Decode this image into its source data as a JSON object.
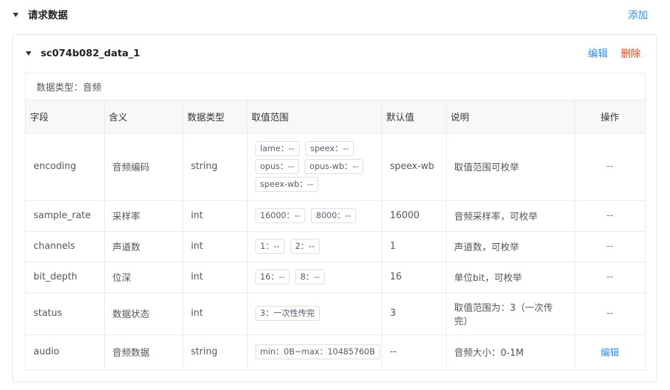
{
  "section": {
    "title": "请求数据",
    "add_label": "添加"
  },
  "card": {
    "title": "sc074b082_data_1",
    "edit_label": "编辑",
    "delete_label": "删除"
  },
  "data_type_line": "数据类型：音频",
  "columns": [
    "字段",
    "含义",
    "数据类型",
    "取值范围",
    "默认值",
    "说明",
    "操作"
  ],
  "rows": [
    {
      "field": "encoding",
      "meaning": "音频编码",
      "type": "string",
      "range": [
        "lame：--",
        "speex：--",
        "opus：--",
        "opus-wb：--",
        "speex-wb：--"
      ],
      "default": "speex-wb",
      "desc": "取值范围可枚举",
      "op": "--",
      "op_link": false
    },
    {
      "field": "sample_rate",
      "meaning": "采样率",
      "type": "int",
      "range": [
        "16000：--",
        "8000：--"
      ],
      "default": "16000",
      "desc": "音频采样率，可枚举",
      "op": "--",
      "op_link": false
    },
    {
      "field": "channels",
      "meaning": "声道数",
      "type": "int",
      "range": [
        "1：--",
        "2：--"
      ],
      "default": "1",
      "desc": "声道数，可枚举",
      "op": "--",
      "op_link": false
    },
    {
      "field": "bit_depth",
      "meaning": "位深",
      "type": "int",
      "range": [
        "16：--",
        "8：--"
      ],
      "default": "16",
      "desc": "单位bit，可枚举",
      "op": "--",
      "op_link": false
    },
    {
      "field": "status",
      "meaning": "数据状态",
      "type": "int",
      "range": [
        "3：一次性传完"
      ],
      "default": "3",
      "desc": "取值范围为：3（一次传完）",
      "op": "--",
      "op_link": false
    },
    {
      "field": "audio",
      "meaning": "音频数据",
      "type": "string",
      "range": [
        "min：0B~max：10485760B"
      ],
      "default": "--",
      "desc": "音频大小：0-1M",
      "op": "编辑",
      "op_link": true
    }
  ],
  "colors": {
    "link": "#2d8cf0",
    "danger": "#ed4014",
    "border": "#e8eaec",
    "header_bg": "#f8f8f9"
  }
}
